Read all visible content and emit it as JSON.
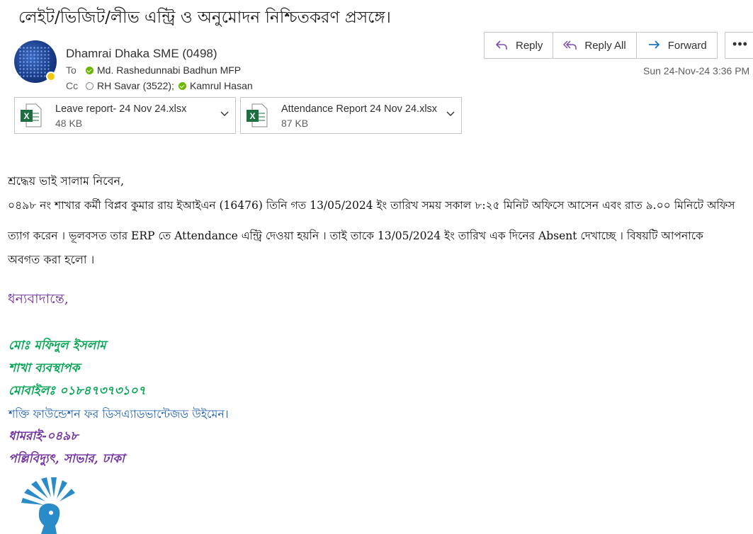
{
  "subject": "লেইট/ভিজিট/লীভ এন্ট্রি ও অনুমোদন নিশ্চিতকরণ প্রসঙ্গে।",
  "header": {
    "sender": "Dhamrai Dhaka SME (0498)",
    "to_label": "To",
    "to": [
      "Md. Rashedunnabi Badhun MFP"
    ],
    "cc_label": "Cc",
    "cc": [
      "RH Savar (3522);",
      "Kamrul Hasan"
    ],
    "datetime": "Sun 24-Nov-24 3:36 PM"
  },
  "actions": {
    "reply": "Reply",
    "reply_all": "Reply All",
    "forward": "Forward",
    "more": "•••"
  },
  "attachments": [
    {
      "name": "Leave report- 24 Nov 24.xlsx",
      "size": "48 KB"
    },
    {
      "name": "Attendance Report 24 Nov 24.xlsx",
      "size": "87 KB"
    }
  ],
  "body": {
    "greeting": "শ্রদ্ধেয় ভাই সালাম নিবেন,",
    "line1": "০৪৯৮ নং শাখার কর্মী বিপ্লব কুমার রায় ইআইএন (16476) তিনি  গত 13/05/2024 ইং তারিখ সময় সকাল ৮:২৫ মিনিট অফিসে আসেন  এবং রাত ৯.০০ মিনিটে অফিস",
    "line2": "ত্যাগ করেন ।  ভূলবসত তার  ERP তে Attendance এন্ট্রি দেওয়া হয়নি । তাই তাকে 13/05/2024 ইং তারিখ এক দিনের Absent দেখাচ্ছে । বিষয়টি আপনাকে",
    "line3": "অবগত করা হলো ।",
    "thanks": "ধন্যবাদান্তে,"
  },
  "signature": {
    "name": "মোঃ মফিদুল ইসলাম",
    "title": "শাখা ব্যবস্থাপক",
    "mobile": "মোবাইলঃ ০১৮৪৭৩৭৩১০৭",
    "org": "শক্তি  ফাউন্ডেশন ফর  ডিসএ্যাডভান্টেজড  উইমেন।",
    "branch": "ধামরাই-০৪৯৮",
    "address": "পল্লিবিদ্যুৎ, সাভার, ঢাকা"
  },
  "colors": {
    "excel_green": "#1d6f42",
    "signature_green": "#00a651",
    "signature_purple": "#7030a0",
    "signature_blue": "#1f5fa8",
    "accent": "#0f6cbd"
  }
}
